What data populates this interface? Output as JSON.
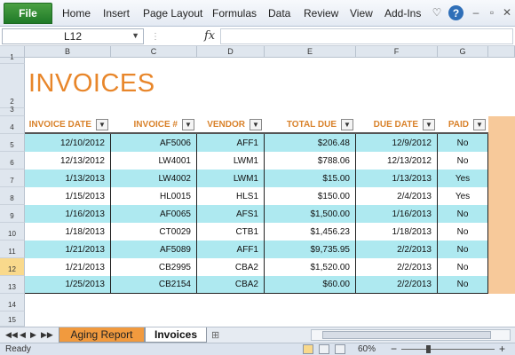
{
  "ribbon": {
    "file_label": "File",
    "tabs": [
      "Home",
      "Insert",
      "Page Layout",
      "Formulas",
      "Data",
      "Review",
      "View",
      "Add-Ins"
    ]
  },
  "formula_bar": {
    "name_box": "L12",
    "fx_label": "fx",
    "value": ""
  },
  "columns": [
    "B",
    "C",
    "D",
    "E",
    "F",
    "G"
  ],
  "title": "INVOICES",
  "table": {
    "headers": [
      "INVOICE DATE",
      "INVOICE #",
      "VENDOR",
      "TOTAL DUE",
      "DUE DATE",
      "PAID"
    ],
    "rows": [
      {
        "row": "5",
        "date": "12/10/2012",
        "invoice": "AF5006",
        "vendor": "AFF1",
        "total": "$206.48",
        "due": "12/9/2012",
        "paid": "No"
      },
      {
        "row": "6",
        "date": "12/13/2012",
        "invoice": "LW4001",
        "vendor": "LWM1",
        "total": "$788.06",
        "due": "12/13/2012",
        "paid": "No"
      },
      {
        "row": "7",
        "date": "1/13/2013",
        "invoice": "LW4002",
        "vendor": "LWM1",
        "total": "$15.00",
        "due": "1/13/2013",
        "paid": "Yes"
      },
      {
        "row": "8",
        "date": "1/15/2013",
        "invoice": "HL0015",
        "vendor": "HLS1",
        "total": "$150.00",
        "due": "2/4/2013",
        "paid": "Yes"
      },
      {
        "row": "9",
        "date": "1/16/2013",
        "invoice": "AF0065",
        "vendor": "AFS1",
        "total": "$1,500.00",
        "due": "1/16/2013",
        "paid": "No"
      },
      {
        "row": "10",
        "date": "1/18/2013",
        "invoice": "CT0029",
        "vendor": "CTB1",
        "total": "$1,456.23",
        "due": "1/18/2013",
        "paid": "No"
      },
      {
        "row": "11",
        "date": "1/21/2013",
        "invoice": "AF5089",
        "vendor": "AFF1",
        "total": "$9,735.95",
        "due": "2/2/2013",
        "paid": "No"
      },
      {
        "row": "12",
        "date": "1/21/2013",
        "invoice": "CB2995",
        "vendor": "CBA2",
        "total": "$1,520.00",
        "due": "2/2/2013",
        "paid": "No"
      },
      {
        "row": "13",
        "date": "1/25/2013",
        "invoice": "CB2154",
        "vendor": "CBA2",
        "total": "$60.00",
        "due": "2/2/2013",
        "paid": "No"
      }
    ]
  },
  "row_numbers_top": [
    "1",
    "2",
    "3",
    "4"
  ],
  "row_numbers_bottom": [
    "14",
    "15"
  ],
  "sheet_tabs": [
    "Aging Report",
    "Invoices"
  ],
  "status": {
    "ready": "Ready",
    "zoom": "60%"
  },
  "colors": {
    "accent_orange": "#e8862a",
    "band_cyan": "#aee9f0",
    "file_green": "#2e8b32",
    "aging_tab": "#f19a3e"
  }
}
